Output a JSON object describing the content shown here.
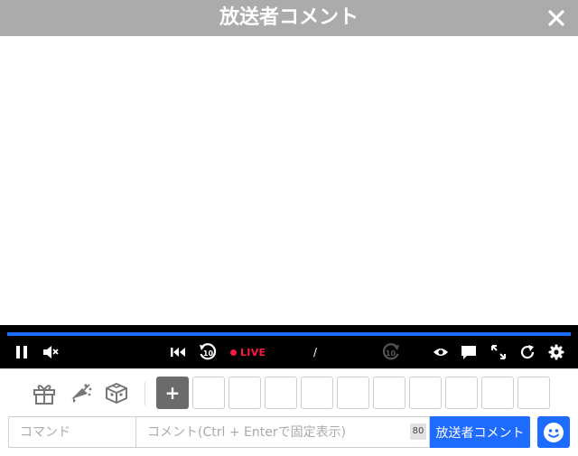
{
  "window": {
    "title": "放送者コメント"
  },
  "player": {
    "live_label": "LIVE",
    "time_separator": "/",
    "progress_color": "#1e6bff",
    "icons": [
      "pause-icon",
      "mute-icon",
      "skip-to-start-icon",
      "rewind-10-icon",
      "forward-10-icon",
      "eye-icon",
      "comment-icon",
      "fullscreen-icon",
      "reload-icon",
      "settings-icon"
    ]
  },
  "toolbar": {
    "tools": [
      "gift-icon",
      "advertise-icon",
      "nicoad-box-icon"
    ],
    "add_label": "+",
    "slot_count": 10
  },
  "inputs": {
    "command_placeholder": "コマンド",
    "comment_placeholder": "コメント(Ctrl + Enterで固定表示)",
    "char_counter": "80",
    "send_label": "放送者コメント"
  },
  "colors": {
    "accent": "#1e6bff",
    "live": "#ff1744",
    "titlebar": "#ababab"
  }
}
